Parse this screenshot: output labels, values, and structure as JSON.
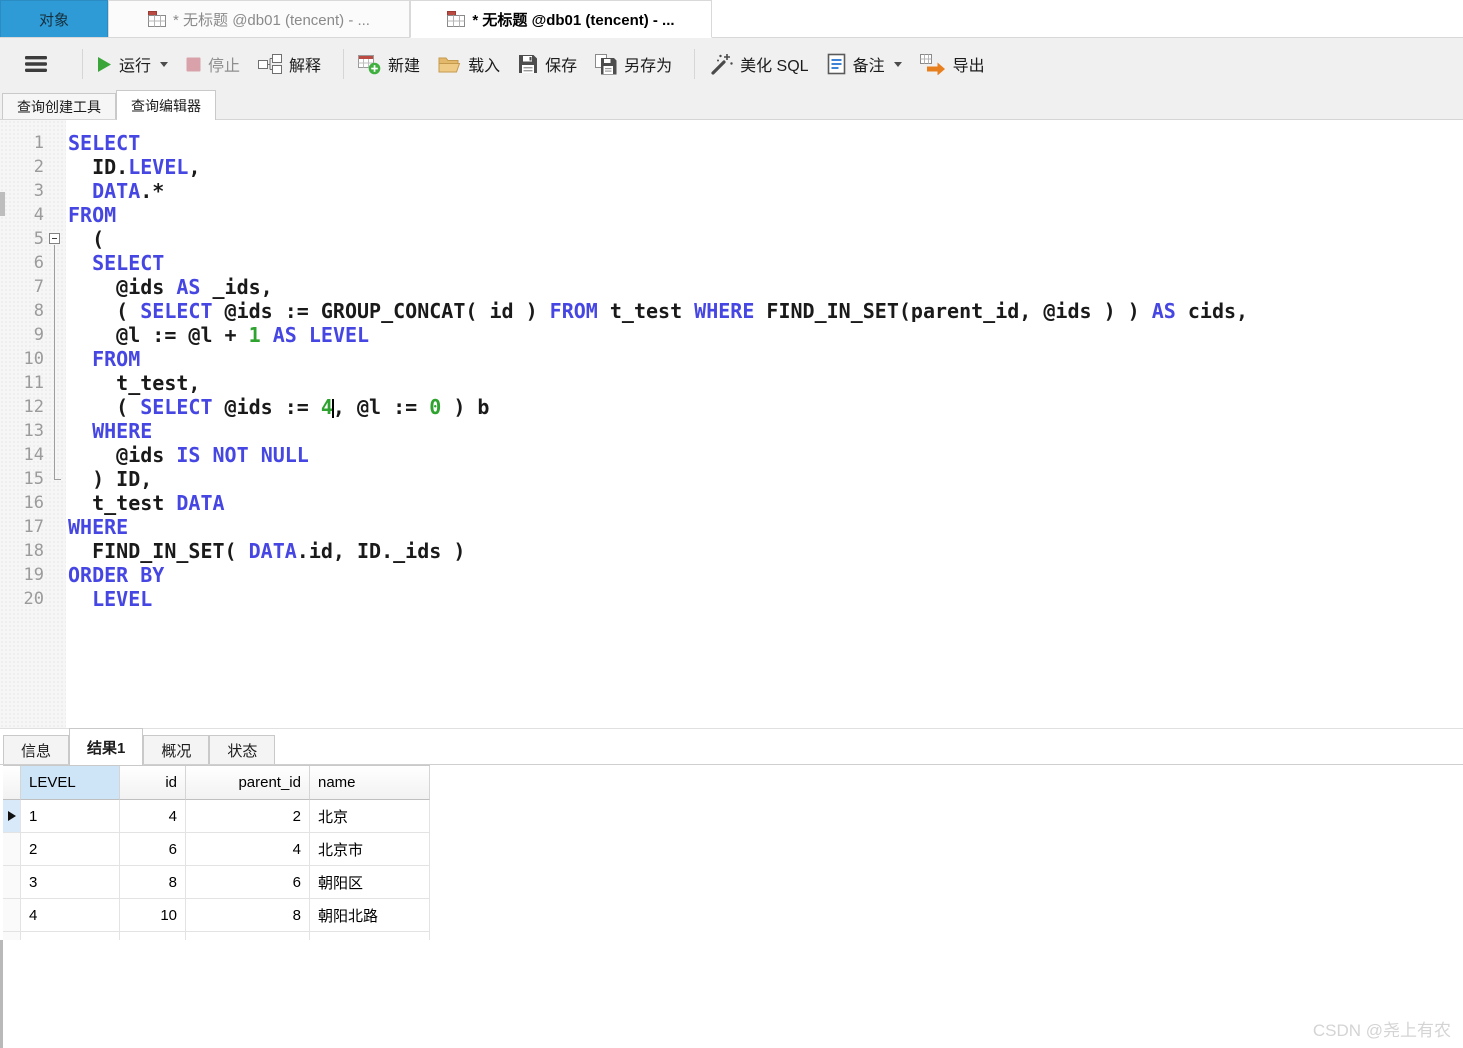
{
  "window_tabs": [
    {
      "label": "对象"
    },
    {
      "label": "* 无标题 @db01 (tencent) - ..."
    },
    {
      "label": "* 无标题 @db01 (tencent) - ..."
    }
  ],
  "toolbar": {
    "run": "运行",
    "stop": "停止",
    "explain": "解释",
    "new_query": "新建",
    "load": "载入",
    "save": "保存",
    "save_as": "另存为",
    "beautify_sql": "美化 SQL",
    "note": "备注",
    "export": "导出"
  },
  "editor_tabs": [
    {
      "label": "查询创建工具",
      "active": false
    },
    {
      "label": "查询编辑器",
      "active": true
    }
  ],
  "code": {
    "lines": [
      {
        "n": "1",
        "fold": "",
        "tokens": [
          [
            "k",
            "SELECT"
          ]
        ]
      },
      {
        "n": "2",
        "fold": "",
        "tokens": [
          [
            "p",
            "  ID."
          ],
          [
            "k",
            "LEVEL"
          ],
          [
            "p",
            ","
          ]
        ]
      },
      {
        "n": "3",
        "fold": "",
        "tokens": [
          [
            "p",
            "  "
          ],
          [
            "k",
            "DATA"
          ],
          [
            "p",
            ".*"
          ]
        ]
      },
      {
        "n": "4",
        "fold": "",
        "tokens": [
          [
            "k",
            "FROM"
          ]
        ]
      },
      {
        "n": "5",
        "fold": "start",
        "tokens": [
          [
            "p",
            "  ("
          ]
        ]
      },
      {
        "n": "6",
        "fold": "mid",
        "tokens": [
          [
            "p",
            "  "
          ],
          [
            "k",
            "SELECT"
          ]
        ]
      },
      {
        "n": "7",
        "fold": "mid",
        "tokens": [
          [
            "p",
            "    @ids "
          ],
          [
            "k",
            "AS"
          ],
          [
            "p",
            " _ids,"
          ]
        ]
      },
      {
        "n": "8",
        "fold": "mid",
        "tokens": [
          [
            "p",
            "    ( "
          ],
          [
            "k",
            "SELECT"
          ],
          [
            "p",
            " @ids := GROUP_CONCAT( id ) "
          ],
          [
            "k",
            "FROM"
          ],
          [
            "p",
            " t_test "
          ],
          [
            "k",
            "WHERE"
          ],
          [
            "p",
            " FIND_IN_SET(parent_id, @ids ) ) "
          ],
          [
            "k",
            "AS"
          ],
          [
            "p",
            " cids,"
          ]
        ]
      },
      {
        "n": "9",
        "fold": "mid",
        "tokens": [
          [
            "p",
            "    @l := @l + "
          ],
          [
            "n",
            "1"
          ],
          [
            "p",
            " "
          ],
          [
            "k",
            "AS"
          ],
          [
            "p",
            " "
          ],
          [
            "k",
            "LEVEL"
          ]
        ]
      },
      {
        "n": "10",
        "fold": "mid",
        "tokens": [
          [
            "p",
            "  "
          ],
          [
            "k",
            "FROM"
          ]
        ]
      },
      {
        "n": "11",
        "fold": "mid",
        "tokens": [
          [
            "p",
            "    t_test,"
          ]
        ]
      },
      {
        "n": "12",
        "fold": "mid",
        "tokens": [
          [
            "p",
            "    ( "
          ],
          [
            "k",
            "SELECT"
          ],
          [
            "p",
            " @ids := "
          ],
          [
            "n",
            "4"
          ],
          [
            "caret",
            ""
          ],
          [
            "p",
            ", @l := "
          ],
          [
            "n",
            "0"
          ],
          [
            "p",
            " ) b"
          ]
        ]
      },
      {
        "n": "13",
        "fold": "mid",
        "tokens": [
          [
            "p",
            "  "
          ],
          [
            "k",
            "WHERE"
          ]
        ]
      },
      {
        "n": "14",
        "fold": "mid",
        "tokens": [
          [
            "p",
            "    @ids "
          ],
          [
            "k",
            "IS"
          ],
          [
            "p",
            " "
          ],
          [
            "k",
            "NOT"
          ],
          [
            "p",
            " "
          ],
          [
            "k",
            "NULL"
          ]
        ]
      },
      {
        "n": "15",
        "fold": "end",
        "tokens": [
          [
            "p",
            "  ) ID,"
          ]
        ]
      },
      {
        "n": "16",
        "fold": "",
        "tokens": [
          [
            "p",
            "  t_test "
          ],
          [
            "k",
            "DATA"
          ]
        ]
      },
      {
        "n": "17",
        "fold": "",
        "tokens": [
          [
            "k",
            "WHERE"
          ]
        ]
      },
      {
        "n": "18",
        "fold": "",
        "tokens": [
          [
            "p",
            "  FIND_IN_SET( "
          ],
          [
            "k",
            "DATA"
          ],
          [
            "p",
            ".id, ID._ids )"
          ]
        ]
      },
      {
        "n": "19",
        "fold": "",
        "tokens": [
          [
            "k",
            "ORDER BY"
          ]
        ]
      },
      {
        "n": "20",
        "fold": "",
        "tokens": [
          [
            "p",
            "  "
          ],
          [
            "k",
            "LEVEL"
          ]
        ]
      }
    ]
  },
  "result_tabs": [
    {
      "label": "信息",
      "active": false
    },
    {
      "label": "结果1",
      "active": true
    },
    {
      "label": "概况",
      "active": false
    },
    {
      "label": "状态",
      "active": false
    }
  ],
  "grid": {
    "columns": [
      "LEVEL",
      "id",
      "parent_id",
      "name"
    ],
    "highlighted_column": "LEVEL",
    "rows": [
      [
        "1",
        "4",
        "2",
        "北京"
      ],
      [
        "2",
        "6",
        "4",
        "北京市"
      ],
      [
        "3",
        "8",
        "6",
        "朝阳区"
      ],
      [
        "4",
        "10",
        "8",
        "朝阳北路"
      ]
    ],
    "current_row_index": 0
  },
  "watermark": "CSDN @尧上有农",
  "colors": {
    "accent_tab_blue": "#2e9bd6",
    "keyword": "#4646e2",
    "number": "#2fa32f",
    "toolbar_bg": "#f0f0f0",
    "column_highlight": "#cde5f7",
    "run_green": "#3aa63a",
    "export_orange": "#e87f1f"
  }
}
